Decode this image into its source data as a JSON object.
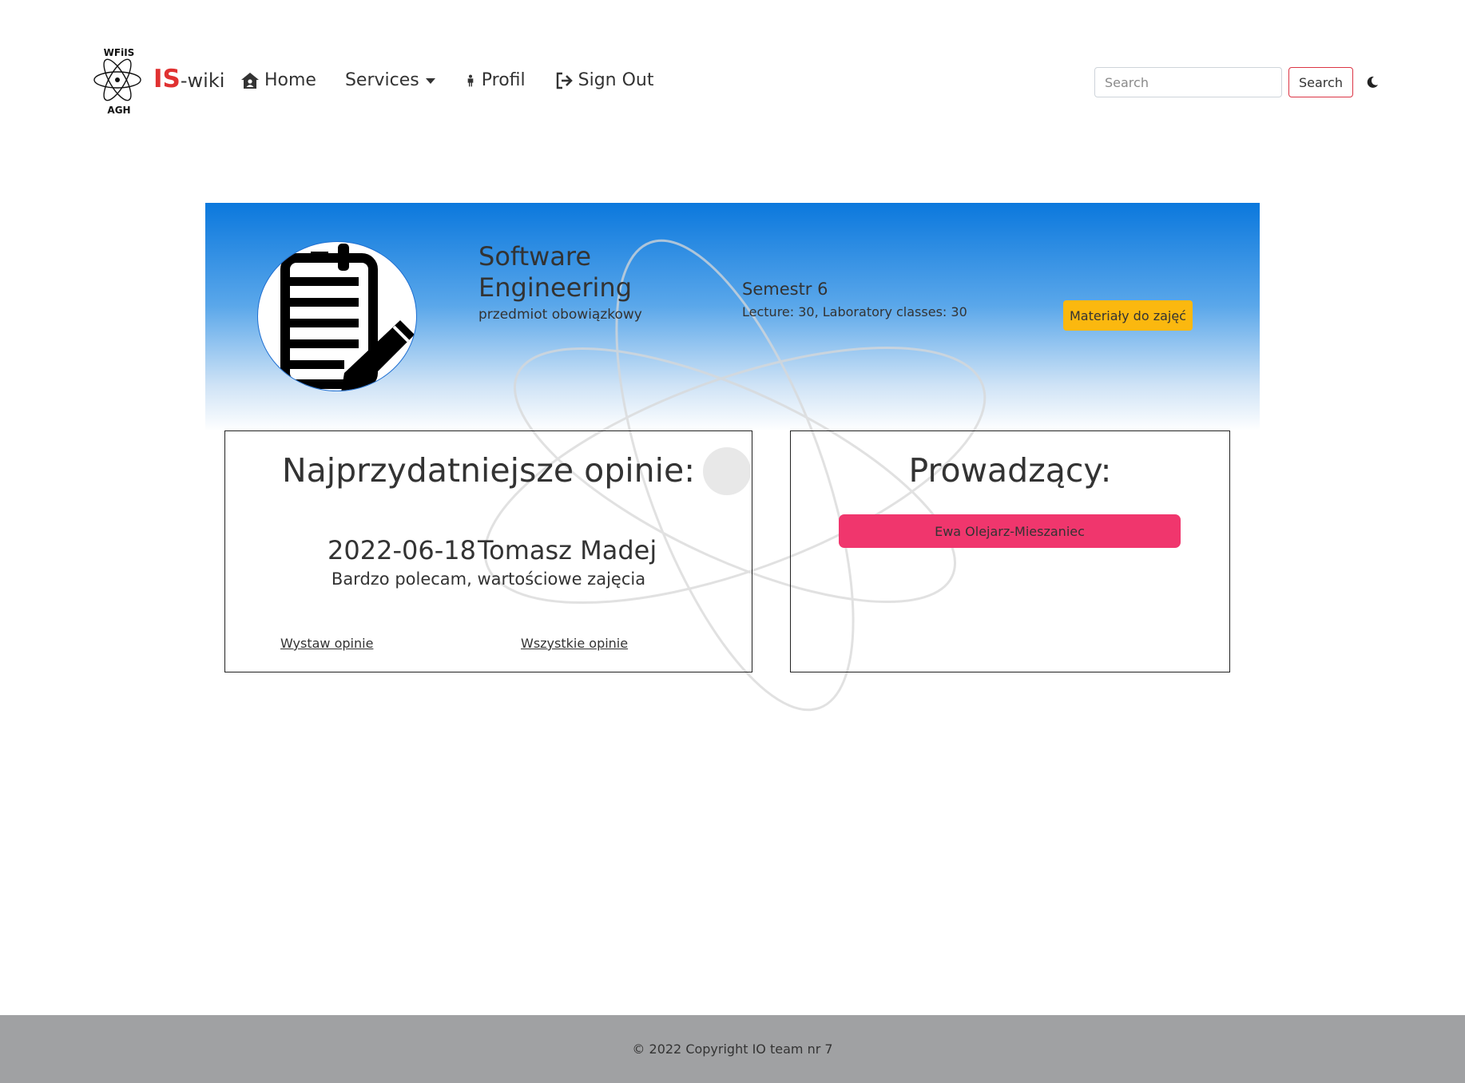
{
  "brand": {
    "logo_top_text": "WFiIS",
    "logo_bottom_text": "AGH",
    "name_accent": "IS",
    "name_rest": "-wiki"
  },
  "nav": {
    "home_label": "Home",
    "services_label": "Services",
    "profil_label": "Profil",
    "signout_label": "Sign Out"
  },
  "search": {
    "placeholder": "Search",
    "button_label": "Search"
  },
  "subject": {
    "title": "Software Engineering",
    "type": "przedmiot obowiązkowy",
    "semester": "Semestr 6",
    "hours": "Lecture: 30, Laboratory classes: 30",
    "materials_label": "Materiały do zajęć"
  },
  "opinions": {
    "heading": "Najprzydatniejsze opinie:",
    "top": {
      "date": "2022-06-18",
      "author": "Tomasz Madej",
      "text": "Bardzo polecam, wartościowe zajęcia"
    },
    "add_label": "Wystaw opinie",
    "all_label": "Wszystkie opinie"
  },
  "teachers": {
    "heading": "Prowadzący:",
    "items": [
      "Ewa Olejarz-Mieszaniec"
    ]
  },
  "footer": {
    "text": "© 2022 Copyright IO team nr 7"
  },
  "colors": {
    "brand_accent": "#e03131",
    "hero_gradient_top": "#0b78dd",
    "materials_button": "#fbb80f",
    "teacher_button": "#f0366d",
    "search_button_border": "#dc3545",
    "footer_bg": "#a0a1a3"
  },
  "icons": {
    "logo": "atom-logo-icon",
    "home": "home-icon",
    "profil": "person-icon",
    "signout": "sign-out-icon",
    "theme": "moon-icon",
    "subject": "document-edit-icon"
  }
}
